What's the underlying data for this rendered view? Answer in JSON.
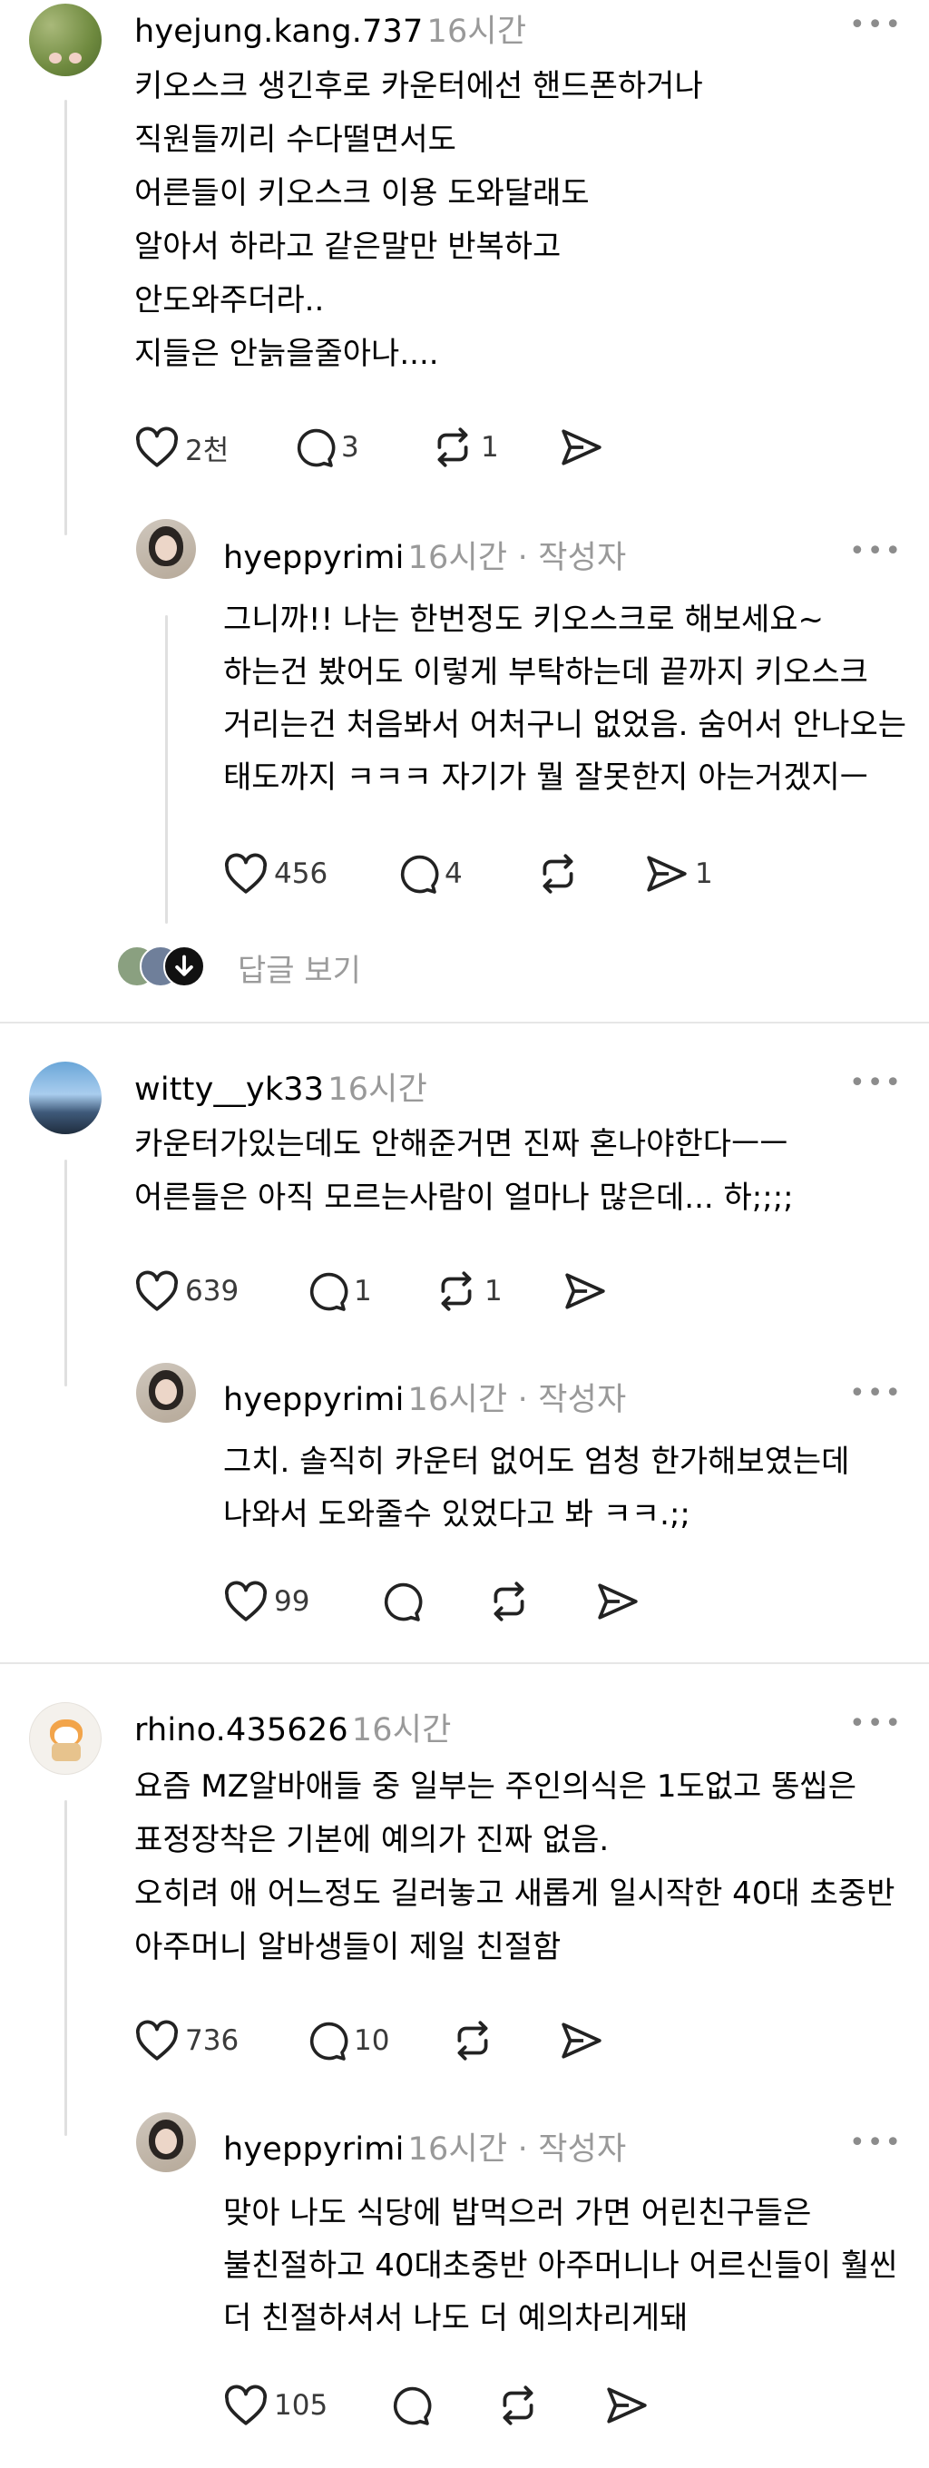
{
  "threads": [
    {
      "comment": {
        "username": "hyejung.kang.737",
        "time": "16시간",
        "lines": [
          "키오스크 생긴후로 카운터에선 핸드폰하거나",
          "직원들끼리 수다떨면서도",
          "어른들이 키오스크 이용 도와달래도",
          "알아서 하라고 같은말만 반복하고",
          "안도와주더라..",
          "지들은 안늙을줄아나...."
        ],
        "likes": "2천",
        "replies": "3",
        "reposts": "1"
      },
      "reply": {
        "username": "hyeppyrimi",
        "time": "16시간 · 작성자",
        "lines": [
          "그니까!! 나는 한번정도 키오스크로 해보세요~",
          "하는건 봤어도 이렇게 부탁하는데 끝까지 키오스크",
          "거리는건 처음봐서 어처구니 없었음. 숨어서 안나오는",
          "태도까지 ㅋㅋㅋ 자기가 뭘 잘못한지 아는거겠지ㅡ"
        ],
        "likes": "456",
        "replies": "4",
        "shares": "1"
      },
      "more_replies_label": "답글 보기"
    },
    {
      "comment": {
        "username": "witty__yk33",
        "time": "16시간",
        "lines": [
          "카운터가있는데도 안해준거면 진짜 혼나야한다ㅡㅡ",
          "어른들은 아직 모르는사람이 얼마나 많은데... 하;;;;"
        ],
        "likes": "639",
        "replies": "1",
        "reposts": "1"
      },
      "reply": {
        "username": "hyeppyrimi",
        "time": "16시간 · 작성자",
        "lines": [
          "그치. 솔직히 카운터 없어도 엄청 한가해보였는데",
          "나와서 도와줄수 있었다고 봐 ㅋㅋ.;;"
        ],
        "likes": "99"
      }
    },
    {
      "comment": {
        "username": "rhino.435626",
        "time": "16시간",
        "lines": [
          "요즘 MZ알바애들 중 일부는 주인의식은 1도없고 똥씹은",
          "표정장착은 기본에 예의가 진짜 없음.",
          "오히려 애 어느정도 길러놓고 새롭게 일시작한 40대 초중반",
          "아주머니 알바생들이 제일 친절함"
        ],
        "likes": "736",
        "replies": "10"
      },
      "reply": {
        "username": "hyeppyrimi",
        "time": "16시간 · 작성자",
        "lines": [
          "맞아 나도 식당에 밥먹으러 가면 어린친구들은",
          "불친절하고 40대초중반 아주머니나 어르신들이 훨씬",
          "더 친절하셔서 나도 더 예의차리게돼"
        ],
        "likes": "105"
      }
    }
  ],
  "icons": {
    "more": "more-dots-icon",
    "like": "heart-icon",
    "reply": "comment-bubble-icon",
    "repost": "repost-arrows-icon",
    "share": "send-paper-plane-icon",
    "show_replies": "arrow-down-circle-icon"
  }
}
